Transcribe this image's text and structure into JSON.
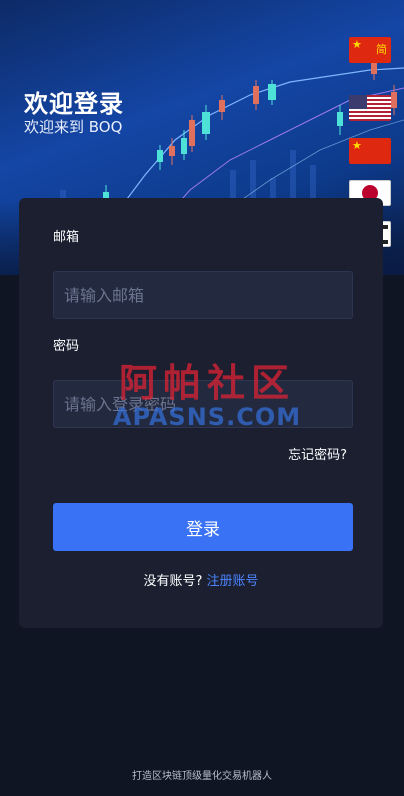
{
  "header": {
    "title": "欢迎登录",
    "subtitle": "欢迎来到 BOQ"
  },
  "languages": [
    {
      "icon": "china-flag-icon",
      "label": "简"
    },
    {
      "icon": "usa-flag-icon"
    },
    {
      "icon": "china-flag-icon"
    },
    {
      "icon": "japan-flag-icon"
    },
    {
      "icon": "korea-flag-icon"
    }
  ],
  "form": {
    "email_label": "邮箱",
    "email_placeholder": "请输入邮箱",
    "email_value": "",
    "password_label": "密码",
    "password_placeholder": "请输入登录密码",
    "password_value": "",
    "forgot_label": "忘记密码?",
    "login_label": "登录",
    "no_account_text": "没有账号?",
    "register_label": "注册账号"
  },
  "watermark": {
    "cn": "阿帕社区",
    "en": "APASNS.COM"
  },
  "footer": {
    "text": "打造区块链顶级量化交易机器人"
  },
  "colors": {
    "page_bg": "#0f1522",
    "card_bg": "#1b1f30",
    "input_bg": "#232a3f",
    "accent": "#3a72f5",
    "link": "#4c84ff"
  }
}
